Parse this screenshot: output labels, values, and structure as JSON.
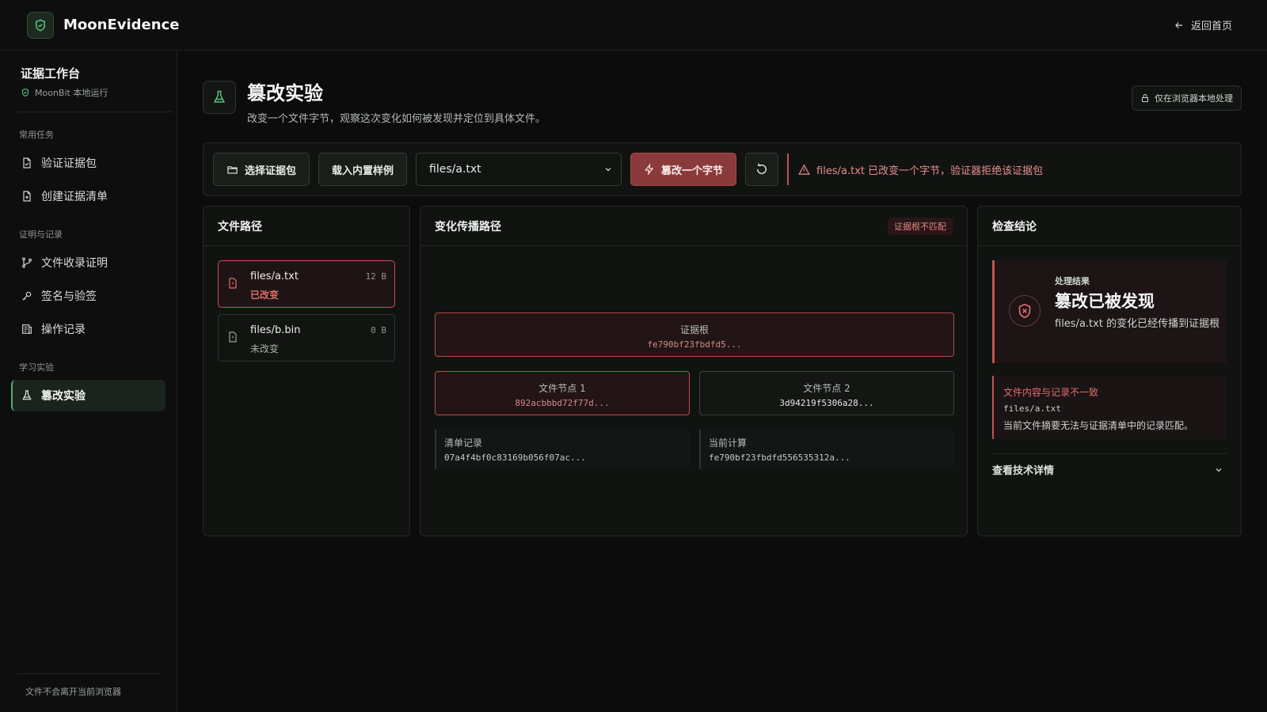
{
  "header": {
    "brand": "MoonEvidence",
    "back_label": "返回首页"
  },
  "sidebar": {
    "workspace_title": "证据工作台",
    "workspace_sub": "MoonBit 本地运行",
    "sections": [
      {
        "label": "常用任务",
        "items": [
          "验证证据包",
          "创建证据清单"
        ]
      },
      {
        "label": "证明与记录",
        "items": [
          "文件收录证明",
          "签名与验签",
          "操作记录"
        ]
      },
      {
        "label": "学习实验",
        "items": [
          "篡改实验"
        ]
      }
    ],
    "active_item": "篡改实验",
    "footer": "文件不会离开当前浏览器"
  },
  "page": {
    "title": "篡改实验",
    "description": "改变一个文件字节，观察这次变化如何被发现并定位到具体文件。",
    "local_badge": "仅在浏览器本地处理"
  },
  "toolbar": {
    "choose_label": "选择证据包",
    "sample_label": "载入内置样例",
    "selected_file": "files/a.txt",
    "tamper_label": "篡改一个字节",
    "alert_text": "files/a.txt 已改变一个字节，验证器拒绝该证据包"
  },
  "files_panel": {
    "title": "文件路径",
    "files": [
      {
        "name": "files/a.txt",
        "size": "12 B",
        "status": "已改变",
        "changed": true
      },
      {
        "name": "files/b.bin",
        "size": "0 B",
        "status": "未改变",
        "changed": false
      }
    ]
  },
  "propagation_panel": {
    "title": "变化传播路径",
    "badge": "证据根不匹配",
    "root": {
      "label": "证据根",
      "hash": "fe790bf23fbdfd5..."
    },
    "nodes": [
      {
        "label": "文件节点 1",
        "hash": "892acbbbd72f77d...",
        "bad": true
      },
      {
        "label": "文件节点 2",
        "hash": "3d94219f5306a28...",
        "bad": false
      }
    ],
    "records": [
      {
        "label": "清单记录",
        "value": "07a4f4bf0c83169b056f07ac..."
      },
      {
        "label": "当前计算",
        "value": "fe790bf23fbdfd556535312a..."
      }
    ]
  },
  "result_panel": {
    "title": "检查结论",
    "kicker": "处理结果",
    "headline": "篡改已被发现",
    "description": "files/a.txt 的变化已经传播到证据根",
    "error_title": "文件内容与记录不一致",
    "error_file": "files/a.txt",
    "error_desc": "当前文件摘要无法与证据清单中的记录匹配。",
    "details_label": "查看技术详情"
  },
  "colors": {
    "accent_green": "#4fae6d",
    "danger": "#c25353",
    "background": "#0b0c0b"
  }
}
